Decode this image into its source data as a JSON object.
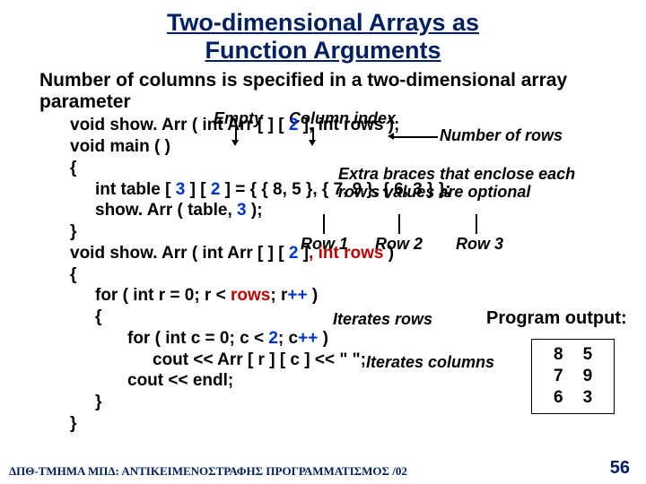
{
  "title_line1": "Two-dimensional Arrays as",
  "title_line2": "Function Arguments",
  "subtitle": "Number of columns is specified in a two-dimensional array parameter",
  "labels": {
    "empty": "Empty",
    "col_index": "Column index",
    "num_rows": "Number of rows",
    "extra_braces_1": "Extra braces that enclose each",
    "extra_braces_2": "row's values are optional",
    "row1": "Row 1",
    "row2": "Row 2",
    "row3": "Row 3",
    "iter_rows": "Iterates rows",
    "iter_cols": "Iterates columns",
    "output_label": "Program output:"
  },
  "code": {
    "l1_a": "void show. Arr ( int Arr [ ] [ ",
    "l1_b": "2",
    "l1_c": " ], int rows );",
    "l2": "void main ( )",
    "l3": "{",
    "l4_a": "int table [ ",
    "l4_b": "3",
    "l4_c": " ] [ ",
    "l4_d": "2",
    "l4_e": " ] = { { 8, 5 }, { 7, 9 }, { 6, 3 } };",
    "l5_a": "show. Arr ( table, ",
    "l5_b": "3",
    "l5_c": " );",
    "l6": "}",
    "l7_a": "void show. Arr ( int Arr [ ] [ ",
    "l7_b": "2",
    "l7_c": " ]",
    "l7_d": ", int rows",
    "l7_e": " )",
    "l8": "{",
    "l9_a": "for ( int r = 0; r < ",
    "l9_b": "rows",
    "l9_c": "; r",
    "l9_d": "++",
    "l9_e": " )",
    "l10": "{",
    "l11_a": "for ( int c = 0; c < ",
    "l11_b": "2",
    "l11_c": "; c",
    "l11_d": "++",
    "l11_e": " )",
    "l12": "cout << Arr [ r ] [ c ] << \"   \";",
    "l13": "cout << endl;",
    "l14": "}",
    "l15": "}"
  },
  "output": {
    "r1c1": "8",
    "r1c2": "5",
    "r2c1": "7",
    "r2c2": "9",
    "r3c1": "6",
    "r3c2": "3"
  },
  "footer": "ΔΠΘ-ΤΜΗΜΑ ΜΠΔ: ΑΝΤΙΚΕΙΜΕΝΟΣΤΡΑΦΗΣ ΠΡΟΓΡΑΜΜΑΤΙΣΜΟΣ /02",
  "page": "56"
}
